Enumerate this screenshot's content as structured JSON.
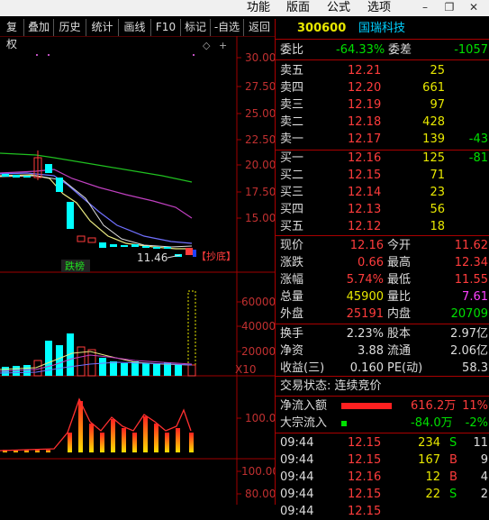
{
  "menu": {
    "items": [
      "功能",
      "版面",
      "公式",
      "选项"
    ]
  },
  "toolbar": {
    "items": [
      "复权",
      "叠加",
      "历史",
      "统计",
      "画线",
      "F10",
      "标记",
      "-自选",
      "返回"
    ]
  },
  "chart": {
    "price_ticks": [
      "30.00",
      "27.50",
      "25.00",
      "22.50",
      "20.00",
      "17.50",
      "15.00"
    ],
    "volume_ticks": [
      "60000",
      "40000",
      "20000"
    ],
    "volume_unit": "X10",
    "indicator_ticks": [
      "100.0"
    ],
    "bottom_ticks": [
      "100.00",
      "80.00"
    ],
    "price_label": "11.46",
    "signal_label": "【抄底】",
    "tag_label": "跌榜"
  },
  "stock": {
    "code": "300600",
    "name": "国瑞科技"
  },
  "quote": {
    "weibi": {
      "label": "委比",
      "value": "-64.33%"
    },
    "weicha": {
      "label": "委差",
      "value": "-1057"
    },
    "asks": [
      {
        "label": "卖五",
        "price": "12.21",
        "vol": "25",
        "chg": ""
      },
      {
        "label": "卖四",
        "price": "12.20",
        "vol": "661",
        "chg": ""
      },
      {
        "label": "卖三",
        "price": "12.19",
        "vol": "97",
        "chg": ""
      },
      {
        "label": "卖二",
        "price": "12.18",
        "vol": "428",
        "chg": ""
      },
      {
        "label": "卖一",
        "price": "12.17",
        "vol": "139",
        "chg": "-43"
      }
    ],
    "bids": [
      {
        "label": "买一",
        "price": "12.16",
        "vol": "125",
        "chg": "-81"
      },
      {
        "label": "买二",
        "price": "12.15",
        "vol": "71",
        "chg": ""
      },
      {
        "label": "买三",
        "price": "12.14",
        "vol": "23",
        "chg": ""
      },
      {
        "label": "买四",
        "price": "12.13",
        "vol": "56",
        "chg": ""
      },
      {
        "label": "买五",
        "price": "12.12",
        "vol": "18",
        "chg": ""
      }
    ],
    "stats": [
      {
        "l1": "现价",
        "v1": "12.16",
        "c1": "r",
        "l2": "今开",
        "v2": "11.62",
        "c2": "r"
      },
      {
        "l1": "涨跌",
        "v1": "0.66",
        "c1": "r",
        "l2": "最高",
        "v2": "12.34",
        "c2": "r"
      },
      {
        "l1": "涨幅",
        "v1": "5.74%",
        "c1": "r",
        "l2": "最低",
        "v2": "11.55",
        "c2": "r"
      },
      {
        "l1": "总量",
        "v1": "45900",
        "c1": "y",
        "l2": "量比",
        "v2": "7.61",
        "c2": "m"
      },
      {
        "l1": "外盘",
        "v1": "25191",
        "c1": "r",
        "l2": "内盘",
        "v2": "20709",
        "c2": "g"
      }
    ],
    "stats2": [
      {
        "l1": "换手",
        "v1": "2.23%",
        "l2": "股本",
        "v2": "2.97亿"
      },
      {
        "l1": "净资",
        "v1": "3.88",
        "l2": "流通",
        "v2": "2.06亿"
      },
      {
        "l1": "收益(三)",
        "v1": "0.160",
        "l2": "PE(动)",
        "v2": "58.3"
      }
    ],
    "trade_status": "交易状态: 连续竞价",
    "net_inflow": {
      "label": "净流入额",
      "value": "616.2万",
      "pct": "11%"
    },
    "block_inflow": {
      "label": "大宗流入",
      "value": "-84.0万",
      "pct": "-2%"
    }
  },
  "ticks": [
    {
      "time": "09:44",
      "price": "12.15",
      "vol": "234",
      "bs": "S",
      "n": "11"
    },
    {
      "time": "09:44",
      "price": "12.15",
      "vol": "167",
      "bs": "B",
      "n": "9"
    },
    {
      "time": "09:44",
      "price": "12.16",
      "vol": "12",
      "bs": "B",
      "n": "4"
    },
    {
      "time": "09:44",
      "price": "12.15",
      "vol": "22",
      "bs": "S",
      "n": "2"
    },
    {
      "time": "09:44",
      "price": "12.15",
      "vol": "",
      "bs": "",
      "n": ""
    }
  ],
  "colors": {
    "up": "#ff3c3c",
    "down": "#00ffff",
    "grid": "#a00000",
    "text": "#dddddd"
  }
}
